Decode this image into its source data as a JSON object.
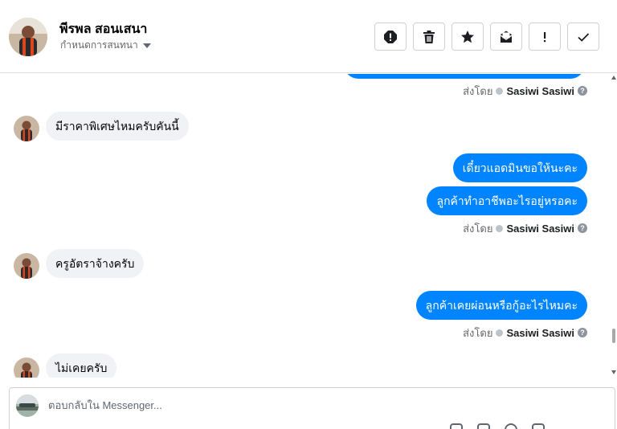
{
  "header": {
    "name": "พีรพล สอนเสนา",
    "subtitle": "กำหนดการสนทนา",
    "actions": [
      {
        "name": "report-icon",
        "glyph": "!"
      },
      {
        "name": "trash-icon",
        "glyph": ""
      },
      {
        "name": "star-icon",
        "glyph": ""
      },
      {
        "name": "mark-unread-icon",
        "glyph": ""
      },
      {
        "name": "important-icon",
        "glyph": "!"
      },
      {
        "name": "check-icon",
        "glyph": ""
      }
    ]
  },
  "thread": {
    "meta_label": "ส่งโดย",
    "sender": "Sasiwi Sasiwi",
    "incoming": [
      "มีราคาพิเศษไหมครับคันนี้",
      "ครูอัตราจ้างครับ",
      "ไม่เคยครับ"
    ],
    "outgoing": [
      "เดี๋ยวแอดมินขอให้นะคะ",
      "ลูกค้าทำอาชีพอะไรอยู่หรอคะ",
      "ลูกค้าเคยผ่อนหรือกู้อะไรไหมคะ"
    ]
  },
  "composer": {
    "placeholder": "ตอบกลับใน Messenger..."
  },
  "colors": {
    "outgoing_bubble": "#0084ff",
    "incoming_bubble": "#f0f2f5",
    "border": "#ccd0d5"
  }
}
